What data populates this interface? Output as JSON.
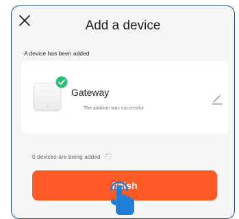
{
  "header": {
    "title": "Add a device",
    "close_icon": "close-icon"
  },
  "added_section": {
    "label": "A device has been added"
  },
  "device": {
    "name": "Gateway",
    "status": "The addition was successful",
    "badge_icon": "check-circle-icon",
    "edit_icon": "pencil-icon"
  },
  "progress": {
    "text": "0 devices are being added",
    "icon": "spinner-icon"
  },
  "actions": {
    "finish_label": "finish"
  },
  "overlay": {
    "icon": "pointer-hand-icon"
  },
  "colors": {
    "accent": "#ff5a26",
    "success": "#2dbf7a",
    "frame_border": "#1d4f86",
    "hand": "#1f7fd6"
  }
}
